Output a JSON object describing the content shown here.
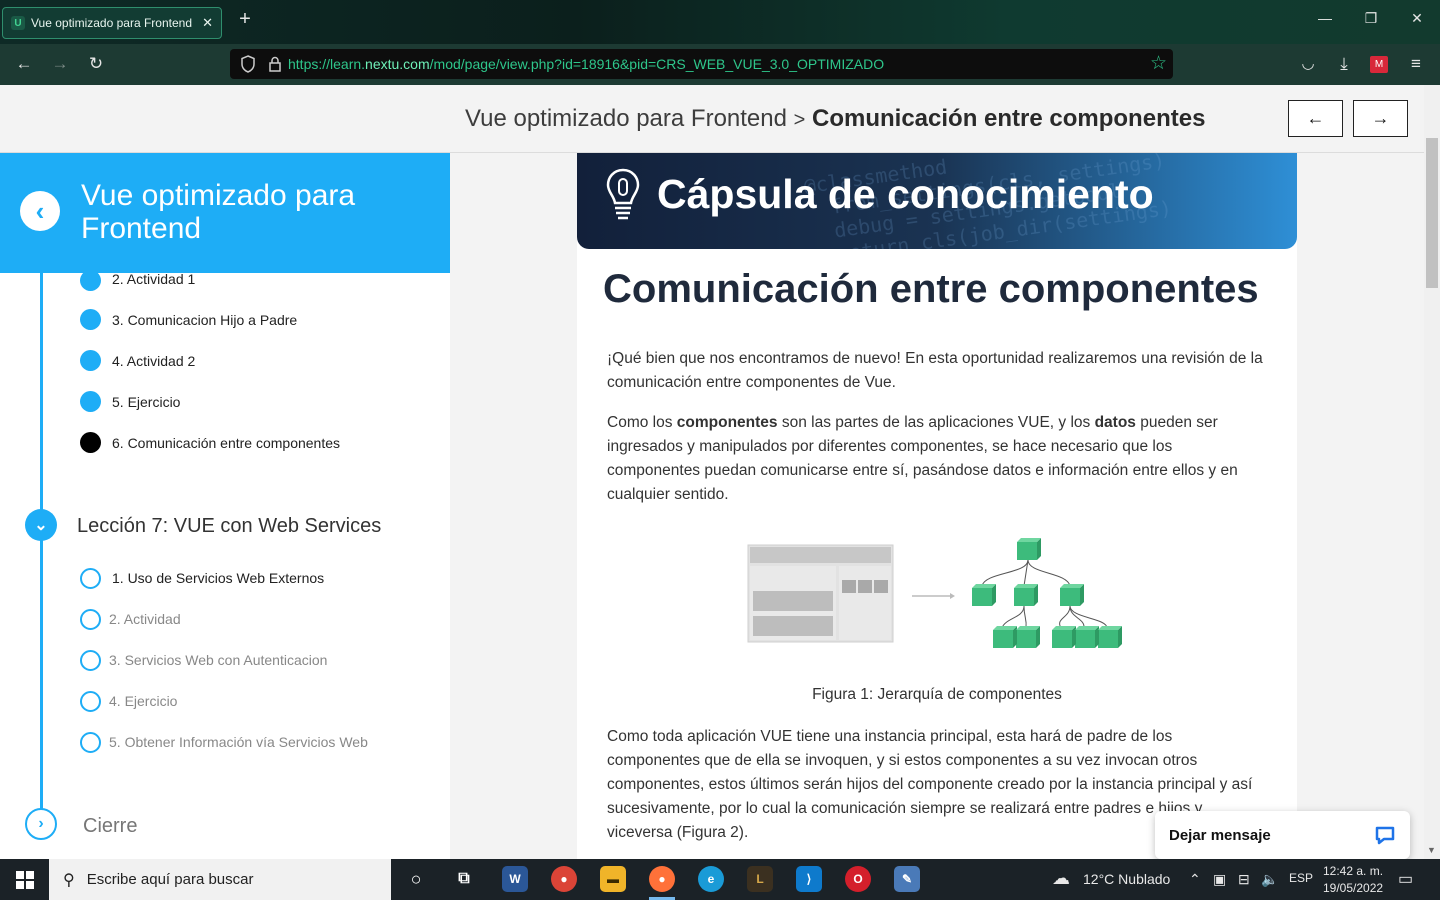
{
  "browser": {
    "tab_title": "Vue optimizado para Frontend",
    "url_prefix": "https://learn.",
    "url_domain": "nextu.com",
    "url_path": "/mod/page/view.php?id=18916&pid=CRS_WEB_VUE_3.0_OPTIMIZADO"
  },
  "header": {
    "course": "Vue optimizado para Frontend",
    "separator": ">",
    "current": "Comunicación entre componentes",
    "prev_label": "←",
    "next_label": "→"
  },
  "sidebar": {
    "title": "Vue optimizado para Frontend",
    "lesson6_items": [
      {
        "label": "2. Actividad 1",
        "state": "done"
      },
      {
        "label": "3. Comunicacion Hijo a Padre",
        "state": "done"
      },
      {
        "label": "4. Actividad 2",
        "state": "done"
      },
      {
        "label": "5. Ejercicio",
        "state": "done"
      },
      {
        "label": "6. Comunicación entre componentes",
        "state": "current"
      }
    ],
    "lesson7": {
      "title": "Lección 7: VUE con Web Services",
      "items": [
        {
          "label": "1. Uso de Servicios Web Externos",
          "state": "available"
        },
        {
          "label": "2. Actividad",
          "state": "locked"
        },
        {
          "label": "3. Servicios Web con Autenticacion",
          "state": "locked"
        },
        {
          "label": "4. Ejercicio",
          "state": "locked"
        },
        {
          "label": "5. Obtener Información vía Servicios Web",
          "state": "locked"
        }
      ]
    },
    "closing": "Cierre"
  },
  "content": {
    "banner_title": "Cápsula de conocimiento",
    "heading": "Comunicación entre componentes",
    "p1": "¡Qué bien que nos encontramos de nuevo! En esta oportunidad realizaremos una revisión de la comunicación entre componentes de Vue.",
    "p2_a": "Como los ",
    "p2_b": "componentes",
    "p2_c": " son las partes de las aplicaciones VUE, y los ",
    "p2_d": "datos",
    "p2_e": " pueden ser ingresados y manipulados por diferentes componentes, se hace necesario que los componentes puedan comunicarse entre sí, pasándose datos e información entre ellos y en cualquier sentido.",
    "caption": "Figura 1: Jerarquía de componentes",
    "p3": "Como toda aplicación VUE tiene una instancia principal, esta hará de padre de los componentes que de ella se invoquen, y si estos componentes a su vez invocan otros componentes, estos últimos serán hijos del componente creado por la instancia principal y así sucesivamente, por lo cual la comunicación siempre se realizará entre padres e hijos y viceversa (Figura 2)."
  },
  "chat": {
    "label": "Dejar mensaje"
  },
  "taskbar": {
    "search_placeholder": "Escribe aquí para buscar",
    "weather": "12°C  Nublado",
    "lang": "ESP",
    "time": "12:42 a. m.",
    "date": "19/05/2022"
  },
  "colors": {
    "accent": "#1eadf6",
    "banner_dark": "#12203a",
    "cube": "#3dbb7c"
  }
}
